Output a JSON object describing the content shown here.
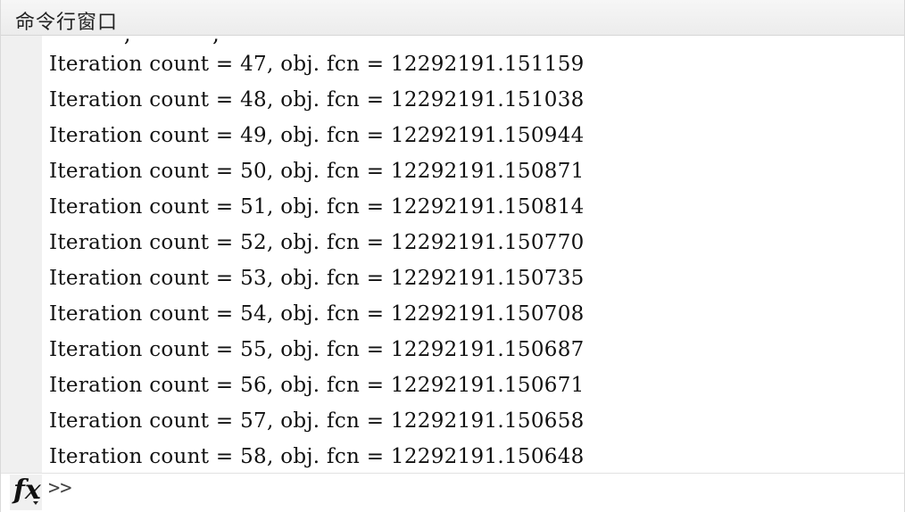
{
  "window": {
    "title": "命令行窗口"
  },
  "output": {
    "clipped_line": "           ,            ,                ",
    "lines": [
      "Iteration count = 47, obj. fcn = 12292191.151159",
      "Iteration count = 48, obj. fcn = 12292191.151038",
      "Iteration count = 49, obj. fcn = 12292191.150944",
      "Iteration count = 50, obj. fcn = 12292191.150871",
      "Iteration count = 51, obj. fcn = 12292191.150814",
      "Iteration count = 52, obj. fcn = 12292191.150770",
      "Iteration count = 53, obj. fcn = 12292191.150735",
      "Iteration count = 54, obj. fcn = 12292191.150708",
      "Iteration count = 55, obj. fcn = 12292191.150687",
      "Iteration count = 56, obj. fcn = 12292191.150671",
      "Iteration count = 57, obj. fcn = 12292191.150658",
      "Iteration count = 58, obj. fcn = 12292191.150648"
    ]
  },
  "prompt": {
    "fx_label": "fx",
    "symbol": ">>",
    "value": ""
  }
}
